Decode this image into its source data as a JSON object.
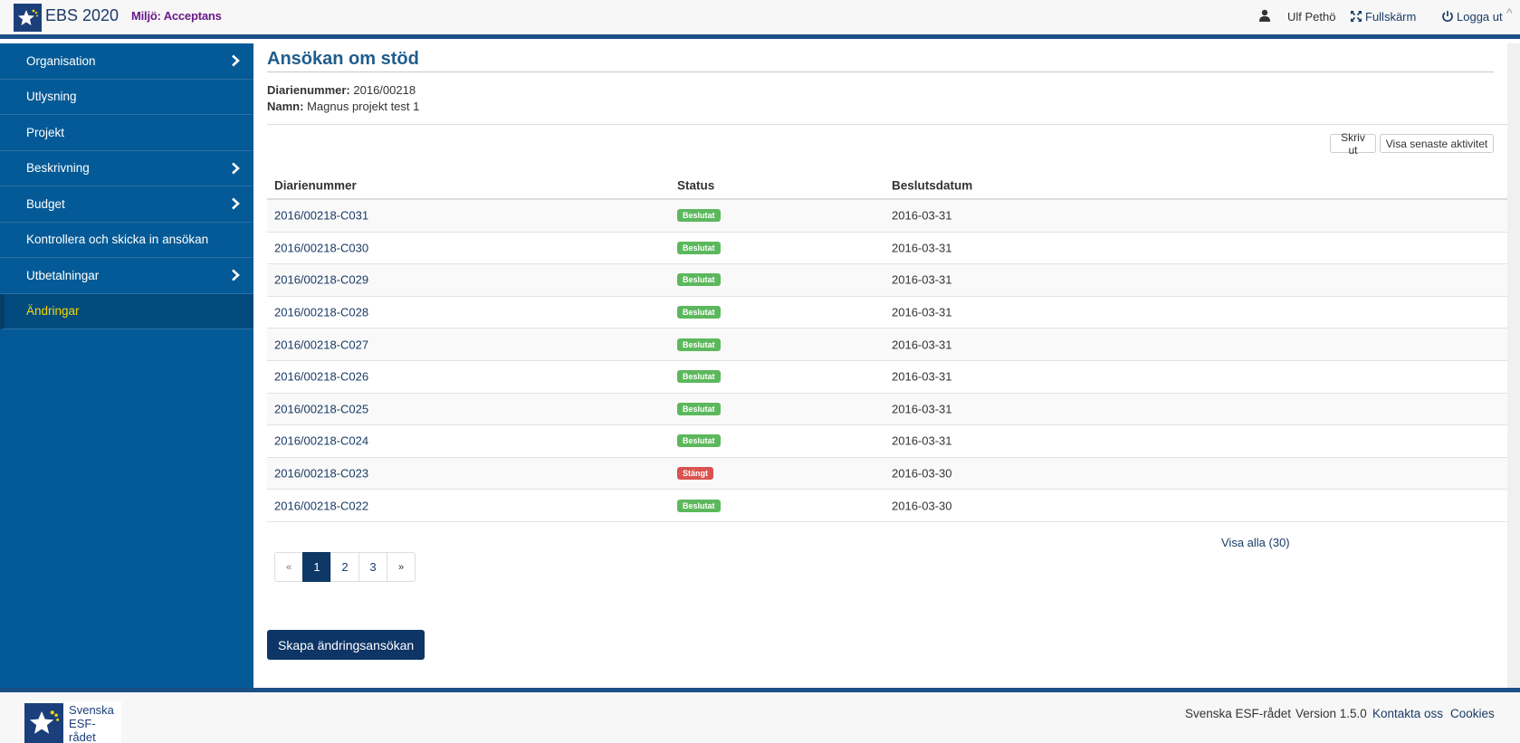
{
  "header": {
    "app_title": "EBS 2020",
    "env_label": "Miljö:",
    "env_value": "Acceptans",
    "user_name": "Ulf Pethö",
    "fullscreen_label": "Fullskärm",
    "logout_label": "Logga ut",
    "icons": [
      "star-logo-icon",
      "user-icon",
      "fullscreen-icon",
      "power-icon",
      "caret-up-icon"
    ]
  },
  "sidebar": {
    "items": [
      {
        "label": "Organisation",
        "has_children": true,
        "active": false
      },
      {
        "label": "Utlysning",
        "has_children": false,
        "active": false
      },
      {
        "label": "Projekt",
        "has_children": false,
        "active": false
      },
      {
        "label": "Beskrivning",
        "has_children": true,
        "active": false
      },
      {
        "label": "Budget",
        "has_children": true,
        "active": false
      },
      {
        "label": "Kontrollera och skicka in ansökan",
        "has_children": false,
        "active": false
      },
      {
        "label": "Utbetalningar",
        "has_children": true,
        "active": false
      },
      {
        "label": "Ändringar",
        "has_children": false,
        "active": true
      }
    ]
  },
  "main": {
    "title": "Ansökan om stöd",
    "diarie_label": "Diarienummer:",
    "diarie_value": "2016/00218",
    "name_label": "Namn:",
    "name_value": "Magnus projekt test 1",
    "print_label": "Skriv ut",
    "activity_label": "Visa senaste aktivitet",
    "table": {
      "headers": [
        "Diarienummer",
        "Status",
        "Beslutsdatum"
      ],
      "rows": [
        {
          "id": "2016/00218-C031",
          "status": "Beslutat",
          "status_color": "#5cb85c",
          "date": "2016-03-31"
        },
        {
          "id": "2016/00218-C030",
          "status": "Beslutat",
          "status_color": "#5cb85c",
          "date": "2016-03-31"
        },
        {
          "id": "2016/00218-C029",
          "status": "Beslutat",
          "status_color": "#5cb85c",
          "date": "2016-03-31"
        },
        {
          "id": "2016/00218-C028",
          "status": "Beslutat",
          "status_color": "#5cb85c",
          "date": "2016-03-31"
        },
        {
          "id": "2016/00218-C027",
          "status": "Beslutat",
          "status_color": "#5cb85c",
          "date": "2016-03-31"
        },
        {
          "id": "2016/00218-C026",
          "status": "Beslutat",
          "status_color": "#5cb85c",
          "date": "2016-03-31"
        },
        {
          "id": "2016/00218-C025",
          "status": "Beslutat",
          "status_color": "#5cb85c",
          "date": "2016-03-31"
        },
        {
          "id": "2016/00218-C024",
          "status": "Beslutat",
          "status_color": "#5cb85c",
          "date": "2016-03-31"
        },
        {
          "id": "2016/00218-C023",
          "status": "Stängt",
          "status_color": "#d9534f",
          "date": "2016-03-30"
        },
        {
          "id": "2016/00218-C022",
          "status": "Beslutat",
          "status_color": "#5cb85c",
          "date": "2016-03-30"
        }
      ]
    },
    "show_all_label": "Visa alla (30)",
    "pagination": {
      "prev": "«",
      "pages": [
        "1",
        "2",
        "3"
      ],
      "current": "1",
      "next": "»"
    },
    "create_button": "Skapa ändringsansökan"
  },
  "footer": {
    "logo_line1": "Svenska",
    "logo_line2": "ESF-rådet",
    "org": "Svenska ESF-rådet",
    "version": "Version 1.5.0",
    "contact": "Kontakta oss",
    "cookies": "Cookies"
  },
  "colors": {
    "header_bg": "#f7f7f7",
    "brand_blue": "#1b4f87",
    "sidebar_bg": "#045a96",
    "active_text": "#f5d800",
    "env_purple": "#6a1a8a",
    "primary_button": "#0d3566"
  }
}
